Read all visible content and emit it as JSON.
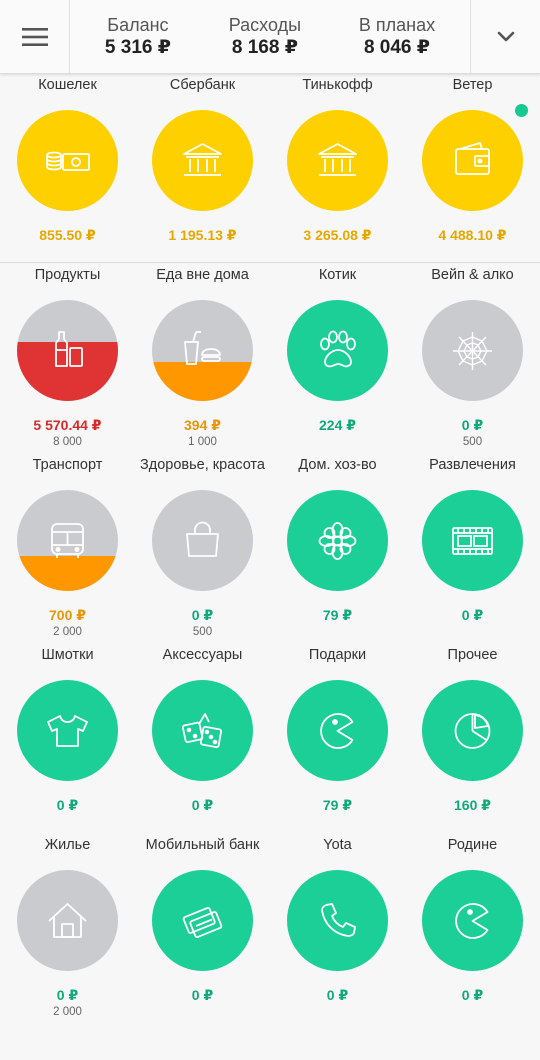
{
  "colors": {
    "yellow": "#ffd000",
    "green": "#1ccf97",
    "gray": "#c9cbcf",
    "red": "#e03333",
    "orange": "#ff9800",
    "value_yellow": "#e6a800",
    "value_green": "#12a97a",
    "value_red": "#d62b2b",
    "value_orange": "#e8960c"
  },
  "header": {
    "balance_label": "Баланс",
    "balance_value": "5 316 ₽",
    "expenses_label": "Расходы",
    "expenses_value": "8 168 ₽",
    "planned_label": "В планах",
    "planned_value": "8 046 ₽",
    "menu_icon": "hamburger-menu-icon",
    "expand_icon": "chevron-down-icon"
  },
  "accounts": [
    {
      "label": "Кошелек",
      "value": "855.50 ₽",
      "icon": "cash-coins-icon"
    },
    {
      "label": "Сбербанк",
      "value": "1 195.13 ₽",
      "icon": "bank-icon"
    },
    {
      "label": "Тинькофф",
      "value": "3 265.08 ₽",
      "icon": "bank-icon"
    },
    {
      "label": "Ветер",
      "value": "4 488.10 ₽",
      "icon": "wallet-icon",
      "indicator": "online-dot"
    }
  ],
  "categories": [
    {
      "label": "Продукты",
      "value": "5 570.44 ₽",
      "budget": "8 000",
      "icon": "bottles-icon",
      "fill_fraction": 0.58,
      "fill_color": "red",
      "value_color": "value_red"
    },
    {
      "label": "Еда вне дома",
      "value": "394 ₽",
      "budget": "1 000",
      "icon": "fast-food-icon",
      "fill_fraction": 0.39,
      "fill_color": "orange",
      "value_color": "value_orange"
    },
    {
      "label": "Котик",
      "value": "224 ₽",
      "budget": "",
      "icon": "paw-icon",
      "fill_color": "green",
      "value_color": "value_green"
    },
    {
      "label": "Вейп & алко",
      "value": "0 ₽",
      "budget": "500",
      "icon": "spider-web-icon",
      "fill_fraction": 0,
      "fill_color": "gray",
      "value_color": "value_green"
    },
    {
      "label": "Транспорт",
      "value": "700 ₽",
      "budget": "2 000",
      "icon": "bus-icon",
      "fill_fraction": 0.35,
      "fill_color": "orange",
      "value_color": "value_orange"
    },
    {
      "label": "Здоровье, красота",
      "value": "0 ₽",
      "budget": "500",
      "icon": "shopping-bag-icon",
      "fill_fraction": 0,
      "fill_color": "gray",
      "value_color": "value_green"
    },
    {
      "label": "Дом. хоз-во",
      "value": "79 ₽",
      "budget": "",
      "icon": "flower-icon",
      "fill_color": "green",
      "value_color": "value_green"
    },
    {
      "label": "Развлечения",
      "value": "0 ₽",
      "budget": "",
      "icon": "film-strip-icon",
      "fill_color": "green",
      "value_color": "value_green"
    },
    {
      "label": "Шмотки",
      "value": "0 ₽",
      "budget": "",
      "icon": "t-shirt-icon",
      "fill_color": "green",
      "value_color": "value_green"
    },
    {
      "label": "Аксессуары",
      "value": "0 ₽",
      "budget": "",
      "icon": "dice-icon",
      "fill_color": "green",
      "value_color": "value_green"
    },
    {
      "label": "Подарки",
      "value": "79 ₽",
      "budget": "",
      "icon": "pacman-icon",
      "fill_color": "green",
      "value_color": "value_green"
    },
    {
      "label": "Прочее",
      "value": "160 ₽",
      "budget": "",
      "icon": "pie-chart-icon",
      "fill_color": "green",
      "value_color": "value_green"
    },
    {
      "label": "Жилье",
      "value": "0 ₽",
      "budget": "2 000",
      "icon": "house-icon",
      "fill_fraction": 0,
      "fill_color": "gray",
      "value_color": "value_green"
    },
    {
      "label": "Мобильный банк",
      "value": "0 ₽",
      "budget": "",
      "icon": "cards-icon",
      "fill_color": "green",
      "value_color": "value_green"
    },
    {
      "label": "Yota",
      "value": "0 ₽",
      "budget": "",
      "icon": "phone-icon",
      "fill_color": "green",
      "value_color": "value_green"
    },
    {
      "label": "Родине",
      "value": "0 ₽",
      "budget": "",
      "icon": "pacman-icon",
      "fill_color": "green",
      "value_color": "value_green"
    }
  ]
}
